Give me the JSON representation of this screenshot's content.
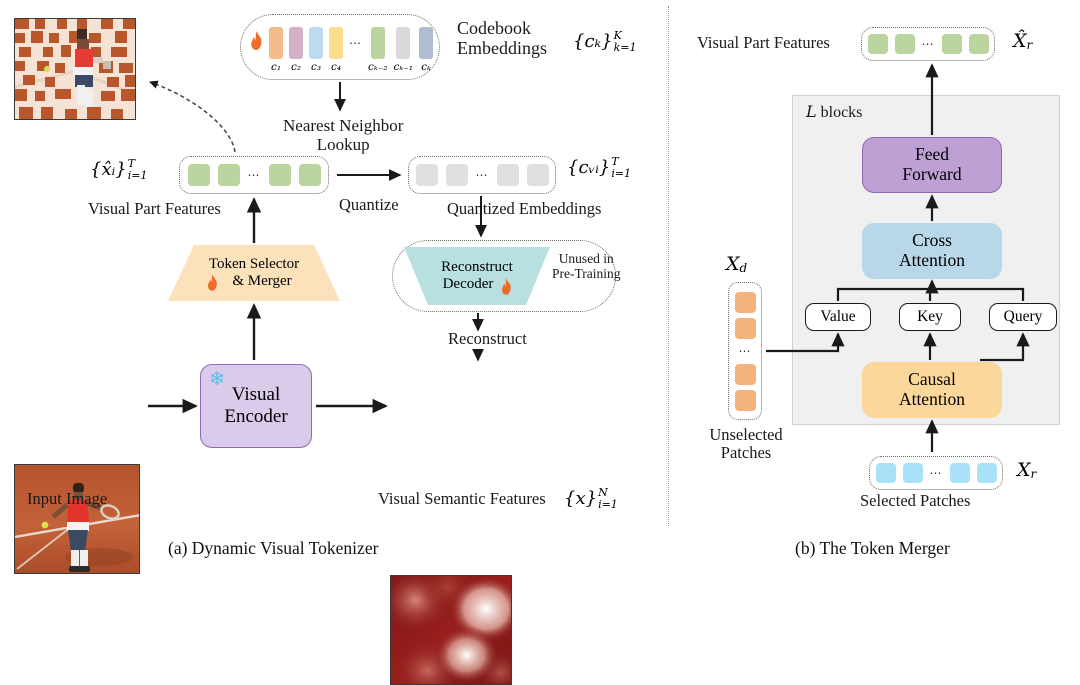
{
  "figure": {
    "captions": {
      "a": "(a) Dynamic Visual Tokenizer",
      "b": "(b) The Token Merger"
    }
  },
  "panel_a": {
    "codebook": {
      "title_line1": "Codebook",
      "title_line2": "Embeddings",
      "notation": "{cₖ}",
      "notation_sup": "K",
      "notation_sub": "k=1",
      "items": [
        {
          "label": "c₁",
          "color": "#f5bc8b"
        },
        {
          "label": "c₂",
          "color": "#d3b0c3"
        },
        {
          "label": "c₃",
          "color": "#bcdbf0"
        },
        {
          "label": "c₄",
          "color": "#fbdd8a"
        },
        {
          "label": "ellipsis",
          "color": "none"
        },
        {
          "label": "cₖ₋₂",
          "color": "#bcd5a0"
        },
        {
          "label": "cₖ₋₁",
          "color": "#d9d9d9"
        },
        {
          "label": "cₖ",
          "color": "#aebdcf"
        }
      ],
      "flame_icon": "flame-icon"
    },
    "nearest_neighbor": {
      "line1": "Nearest Neighbor",
      "line2": "Lookup"
    },
    "visual_part_features": {
      "label": "Visual Part Features",
      "notation": "{x̂ᵢ}",
      "notation_sup": "T",
      "notation_sub": "i=1",
      "token_count": 4,
      "token_color": "#bcd5a0"
    },
    "quantize_label": "Quantize",
    "quantized_embeddings": {
      "label": "Quantized Embeddings",
      "notation": "{cᵥᵢ}",
      "notation_sup": "T",
      "notation_sub": "i=1",
      "token_count": 4,
      "token_color": "#e0e0e0"
    },
    "token_selector": {
      "line1": "Token Selector",
      "line2": "& Merger",
      "color": "#fbe2bb",
      "flame_icon": "flame-icon"
    },
    "reconstruct_decoder": {
      "line1": "Reconstruct",
      "line2": "Decoder",
      "color": "#b8e0e0",
      "flame_icon": "flame-icon",
      "note_line1": "Unused in",
      "note_line2": "Pre-Training"
    },
    "reconstruct_label": "Reconstruct",
    "visual_encoder": {
      "line1": "Visual",
      "line2": "Encoder",
      "color": "#d9cbe9",
      "snowflake_icon": "snowflake-icon"
    },
    "input_image": {
      "label": "Input Image",
      "alt": "tennis-player-photo"
    },
    "masked_image": {
      "alt": "masked-tennis-player-photo"
    },
    "visual_semantic_features": {
      "label": "Visual Semantic Features",
      "notation": "{x}",
      "notation_sup": "N",
      "notation_sub": "i=1",
      "alt": "red-heatmap"
    }
  },
  "panel_b": {
    "output": {
      "label": "Visual Part Features",
      "notation": "X̂",
      "notation_sub": "r",
      "token_count": 4,
      "token_color": "#bcd5a0"
    },
    "blocks_label": "L blocks",
    "feed_forward": {
      "line1": "Feed",
      "line2": "Forward",
      "color": "#bfa0d4"
    },
    "cross_attention": {
      "line1": "Cross",
      "line2": "Attention",
      "color": "#b8d8ea"
    },
    "causal_attention": {
      "line1": "Causal",
      "line2": "Attention",
      "color": "#fbd79b"
    },
    "projections": [
      {
        "label": "Value"
      },
      {
        "label": "Key"
      },
      {
        "label": "Query"
      }
    ],
    "unselected": {
      "notation": "X",
      "notation_sub": "d",
      "label_line1": "Unselected",
      "label_line2": "Patches",
      "token_count": 4,
      "token_color": "#f2b37c"
    },
    "selected": {
      "notation": "X",
      "notation_sub": "r",
      "label": "Selected Patches",
      "token_count": 4,
      "token_color": "#a9e2f8"
    }
  }
}
